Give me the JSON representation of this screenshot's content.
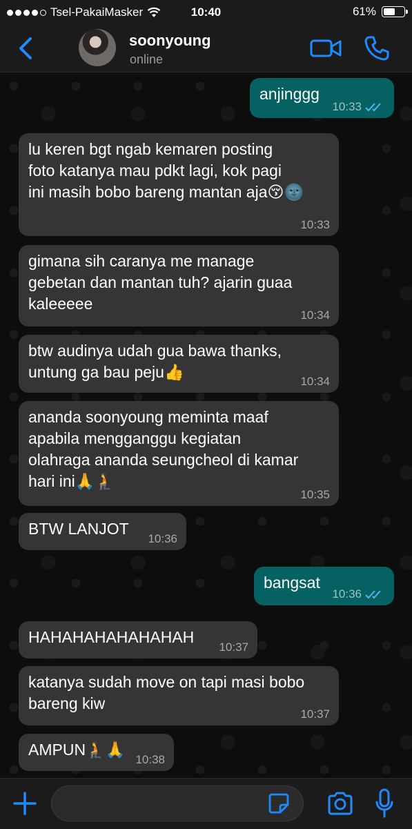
{
  "status_bar": {
    "carrier": "Tsel-PakaiMasker",
    "time": "10:40",
    "battery": "61%",
    "battery_level": 0.61,
    "signal_bars": 4,
    "icons": [
      "wifi-icon",
      "battery-icon"
    ]
  },
  "header": {
    "contact_name": "soonyoung",
    "contact_status": "online",
    "icons": [
      "back-chevron-icon",
      "avatar",
      "video-call-icon",
      "phone-call-icon"
    ]
  },
  "messages": [
    {
      "dir": "out",
      "text": "anjinggg",
      "time": "10:33",
      "read": true
    },
    {
      "dir": "in",
      "text": "lu keren bgt ngab kemaren posting\nfoto katanya mau pdkt lagi, kok pagi\nini masih bobo bareng mantan aja😚🌚",
      "time": "10:33"
    },
    {
      "dir": "in",
      "text": "gimana sih caranya me manage\ngebetan dan mantan tuh? ajarin guaa\nkaleeeee",
      "time": "10:34"
    },
    {
      "dir": "in",
      "text": "btw audinya udah gua bawa thanks,\nuntung ga bau peju👍",
      "time": "10:34"
    },
    {
      "dir": "in",
      "text": "ananda soonyoung meminta maaf\napabila mengganggu kegiatan\nolahraga ananda seungcheol di kamar\nhari ini🙏🧎",
      "time": "10:35"
    },
    {
      "dir": "in",
      "text": "BTW LANJOT",
      "time": "10:36"
    },
    {
      "dir": "out",
      "text": "bangsat",
      "time": "10:36",
      "read": true
    },
    {
      "dir": "in",
      "text": "HAHAHAHAHAHAHAH",
      "time": "10:37"
    },
    {
      "dir": "in",
      "text": "katanya sudah move on tapi masi bobo\nbareng kiw",
      "time": "10:37"
    },
    {
      "dir": "in",
      "text": "AMPUN🧎🙏",
      "time": "10:38"
    }
  ],
  "input_bar": {
    "placeholder": "",
    "icons": [
      "plus-icon",
      "sticker-icon",
      "camera-icon",
      "microphone-icon"
    ]
  },
  "colors": {
    "accent": "#1d8cff",
    "incoming_bubble": "#353535",
    "outgoing_bubble": "#056162",
    "read_ticks": "#4fb6ec"
  }
}
